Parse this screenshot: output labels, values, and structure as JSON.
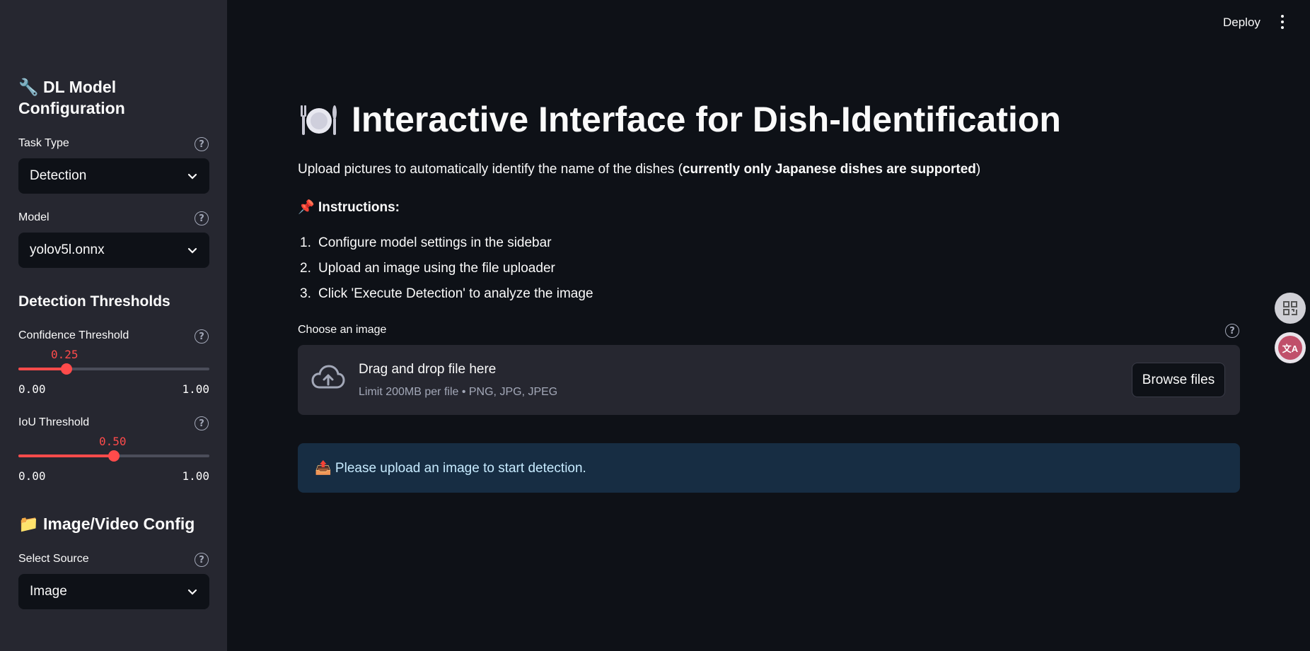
{
  "header": {
    "deploy_label": "Deploy"
  },
  "sidebar": {
    "config_title_line1": "🔧 DL Model",
    "config_title_line2": "Configuration",
    "task_type": {
      "label": "Task Type",
      "value": "Detection"
    },
    "model": {
      "label": "Model",
      "value": "yolov5l.onnx"
    },
    "thresholds_title": "Detection Thresholds",
    "confidence": {
      "label": "Confidence Threshold",
      "value": "0.25",
      "fraction": 0.25,
      "min": "0.00",
      "max": "1.00"
    },
    "iou": {
      "label": "IoU Threshold",
      "value": "0.50",
      "fraction": 0.5,
      "min": "0.00",
      "max": "1.00"
    },
    "source_title": "📁 Image/Video Config",
    "source": {
      "label": "Select Source",
      "value": "Image"
    }
  },
  "main": {
    "title": "Interactive Interface for Dish-Identification",
    "intro_prefix": "Upload pictures to automatically identify the name of the dishes (",
    "intro_bold": "currently only Japanese dishes are supported",
    "intro_suffix": ")",
    "instructions_title": "📌 Instructions:",
    "instructions": [
      {
        "num": "1.",
        "text": "Configure model settings in the sidebar"
      },
      {
        "num": "2.",
        "text": "Upload an image using the file uploader"
      },
      {
        "num": "3.",
        "text": "Click 'Execute Detection' to analyze the image"
      }
    ],
    "uploader": {
      "label": "Choose an image",
      "drag_text": "Drag and drop file here",
      "limit_text": "Limit 200MB per file • PNG, JPG, JPEG",
      "browse_label": "Browse files"
    },
    "info_message": "📤 Please upload an image to start detection."
  },
  "colors": {
    "accent": "#ff4b4b",
    "background": "#0e1117",
    "sidebar": "#262730",
    "info_bg": "#172d43"
  }
}
